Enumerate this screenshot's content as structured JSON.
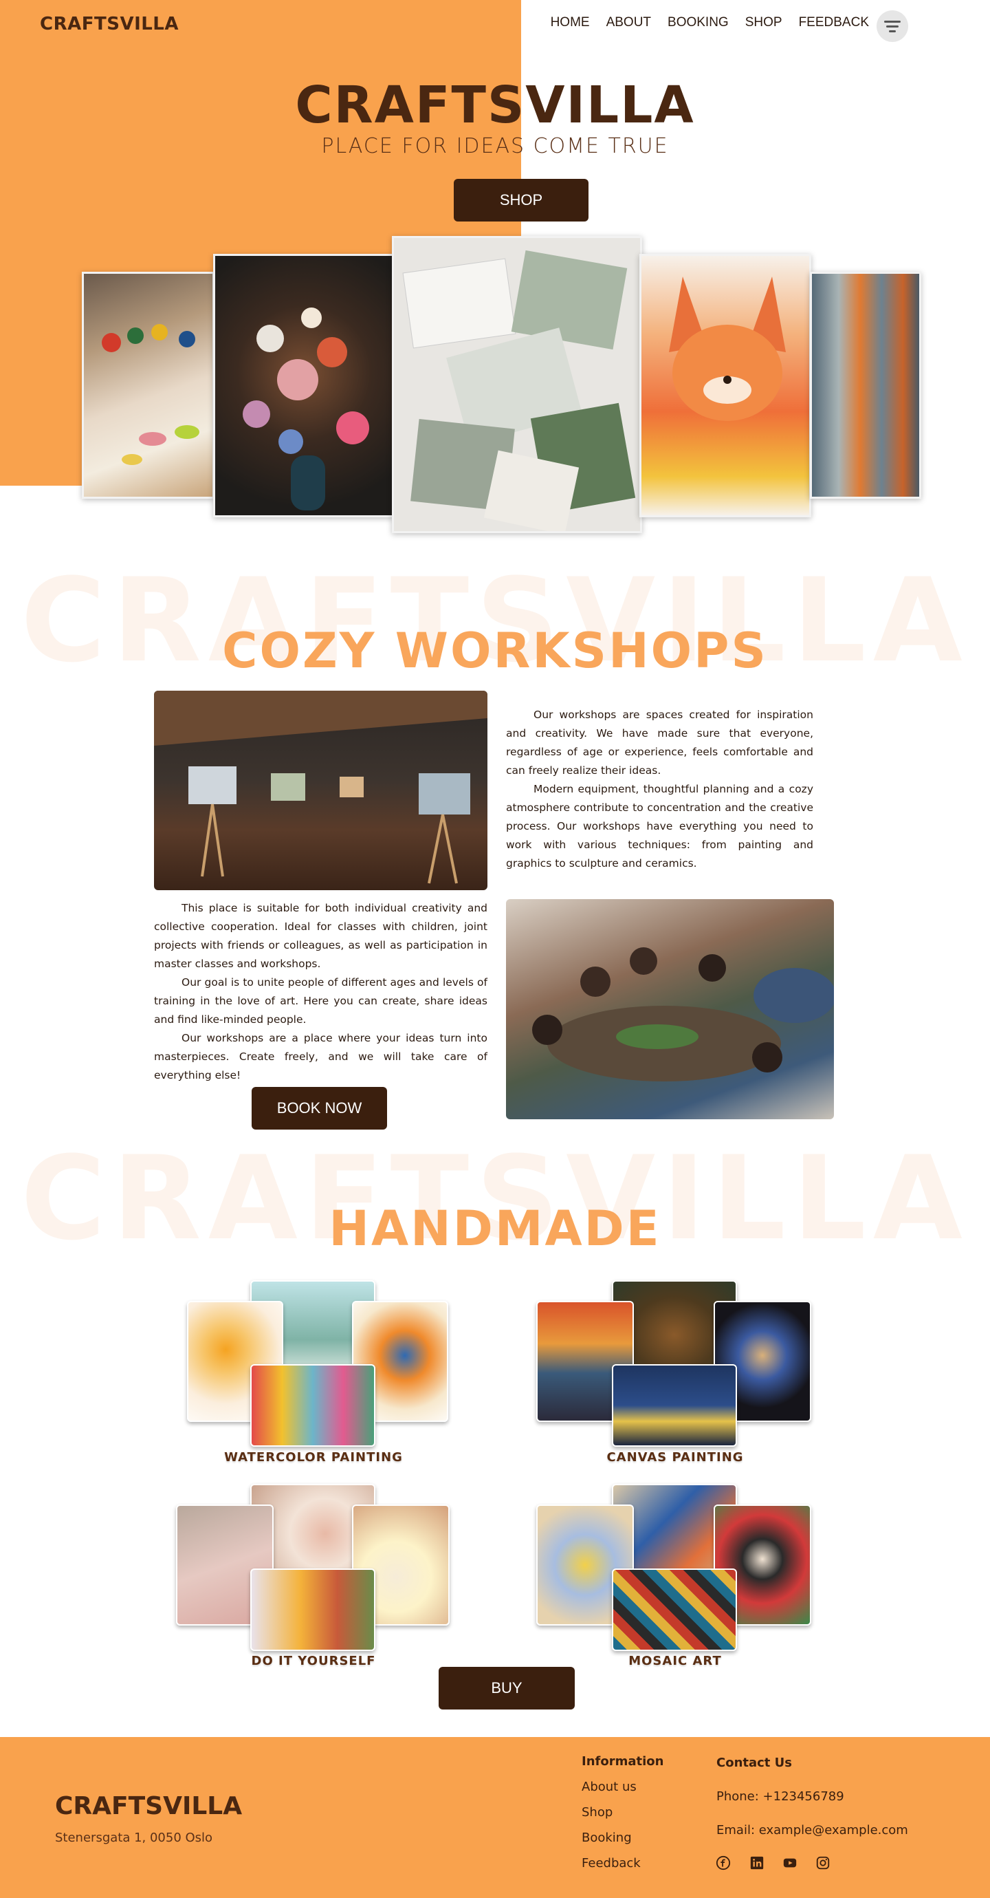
{
  "header": {
    "logo": "CRAFTSVILLA",
    "nav": [
      "HOME",
      "ABOUT",
      "BOOKING",
      "SHOP",
      "FEEDBACK"
    ]
  },
  "hero": {
    "title": "CRAFTSVILLA",
    "subtitle": "PLACE FOR IDEAS COME TRUE",
    "button": "SHOP"
  },
  "workshops": {
    "watermark": "CRAFTSVILLA",
    "title": "COZY WORKSHOPS",
    "paragraphs_right": [
      "Our workshops are spaces created for inspiration and creativity. We have made sure that everyone, regardless of age or experience, feels comfortable and can freely realize their ideas.",
      "Modern equipment, thoughtful planning and a cozy atmosphere contribute to concentration and the creative process. Our workshops have everything you need to work with various techniques: from painting and graphics to sculpture and ceramics."
    ],
    "paragraphs_left": [
      "This place is suitable for both individual creativity and collective cooperation. Ideal for classes with children, joint projects with friends or colleagues, as well as participation in master classes and workshops.",
      "Our goal is to unite people of different ages and levels of training in the love of art. Here you can create, share ideas and find like-minded people.",
      "Our workshops are a place where your ideas turn into masterpieces. Create freely, and we will take care of everything else!"
    ],
    "button": "BOOK NOW"
  },
  "handmade": {
    "watermark": "CRAFTSVILLA",
    "title": "HANDMADE",
    "categories": [
      "WATERCOLOR PAINTING",
      "CANVAS PAINTING",
      "DO IT YOURSELF",
      "MOSAIC ART"
    ],
    "button": "BUY"
  },
  "footer": {
    "logo": "CRAFTSVILLA",
    "address": "Stenersgata 1, 0050 Oslo",
    "info_title": "Information",
    "info_links": [
      "About us",
      "Shop",
      "Booking",
      "Feedback"
    ],
    "contact_title": "Contact Us",
    "phone": "Phone: +123456789",
    "email": "Email: example@example.com",
    "social_icons": [
      "facebook-icon",
      "linkedin-icon",
      "youtube-icon",
      "instagram-icon"
    ]
  },
  "colors": {
    "accent": "#f9a24d",
    "brand_dark": "#4a2711",
    "button": "#3b1f0e",
    "section_title": "#f9a65b"
  }
}
